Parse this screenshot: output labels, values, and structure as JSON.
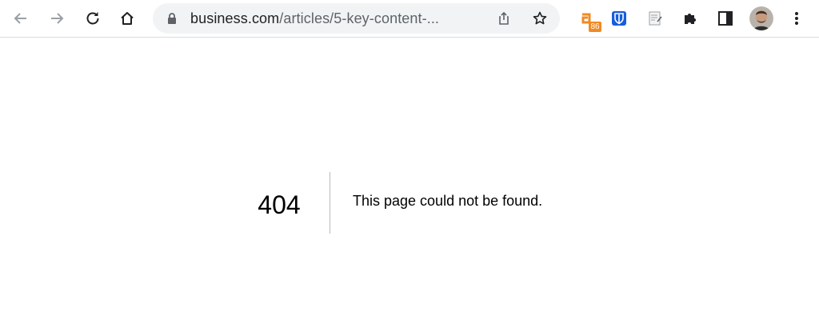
{
  "browser": {
    "url": {
      "host": "business.com",
      "path": "/articles/5-key-content-..."
    },
    "extensions": {
      "first_badge": "86"
    }
  },
  "page": {
    "error_code": "404",
    "error_message": "This page could not be found."
  },
  "colors": {
    "badge": "#f08a24",
    "password_manager": "#175ddc",
    "divider": "#b9b9b9"
  }
}
